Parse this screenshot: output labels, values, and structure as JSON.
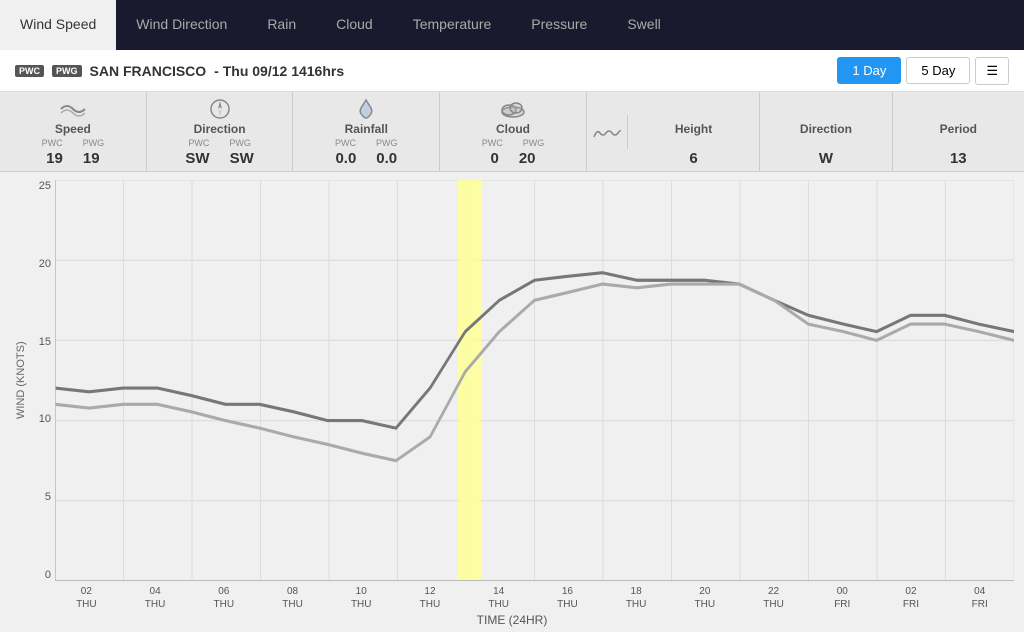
{
  "nav": {
    "tabs": [
      {
        "label": "Wind Speed",
        "active": true
      },
      {
        "label": "Wind Direction",
        "active": false
      },
      {
        "label": "Rain",
        "active": false
      },
      {
        "label": "Cloud",
        "active": false
      },
      {
        "label": "Temperature",
        "active": false
      },
      {
        "label": "Pressure",
        "active": false
      },
      {
        "label": "Swell",
        "active": false
      }
    ]
  },
  "header": {
    "badge1": "PWC",
    "badge2": "PWG",
    "location": "SAN FRANCISCO",
    "datetime": "- Thu 09/12 1416hrs",
    "btn1day": "1 Day",
    "btn5day": "5 Day",
    "menuIcon": "☰"
  },
  "dataRow": {
    "sections": [
      {
        "icon": "wind",
        "label": "Speed",
        "sublabels": [
          "PWC",
          "PWG"
        ],
        "values": [
          "19",
          "19"
        ]
      },
      {
        "icon": "compass",
        "label": "Direction",
        "sublabels": [
          "PWC",
          "PWG"
        ],
        "values": [
          "SW",
          "SW"
        ]
      },
      {
        "icon": "rain",
        "label": "Rainfall",
        "sublabels": [
          "PWC",
          "PWG"
        ],
        "values": [
          "0.0",
          "0.0"
        ]
      },
      {
        "icon": "cloud",
        "label": "Cloud",
        "sublabels": [
          "PWC",
          "PWG"
        ],
        "values": [
          "0",
          "20"
        ]
      }
    ],
    "swell": {
      "label": "Swell",
      "subsections": [
        {
          "label": "Height",
          "sublabels": [],
          "value": "6"
        },
        {
          "label": "Direction",
          "sublabels": [],
          "value": "W"
        },
        {
          "label": "Period",
          "sublabels": [],
          "value": "13"
        }
      ]
    }
  },
  "chart": {
    "yLabel": "WIND (KNOTS)",
    "xLabel": "TIME (24HR)",
    "yTicks": [
      "25",
      "20",
      "15",
      "10",
      "5",
      "0"
    ],
    "xTicks": [
      {
        "time": "02",
        "day": "THU"
      },
      {
        "time": "04",
        "day": "THU"
      },
      {
        "time": "06",
        "day": "THU"
      },
      {
        "time": "08",
        "day": "THU"
      },
      {
        "time": "10",
        "day": "THU"
      },
      {
        "time": "12",
        "day": "THU"
      },
      {
        "time": "14",
        "day": "THU"
      },
      {
        "time": "16",
        "day": "THU"
      },
      {
        "time": "18",
        "day": "THU"
      },
      {
        "time": "20",
        "day": "THU"
      },
      {
        "time": "22",
        "day": "THU"
      },
      {
        "time": "00",
        "day": "FRI"
      },
      {
        "time": "02",
        "day": "FRI"
      },
      {
        "time": "04",
        "day": "FRI"
      }
    ],
    "highlightX": 6,
    "colors": {
      "line1": "#888",
      "line2": "#aaa",
      "grid": "#ddd",
      "highlight": "rgba(255,255,150,0.85)"
    }
  }
}
